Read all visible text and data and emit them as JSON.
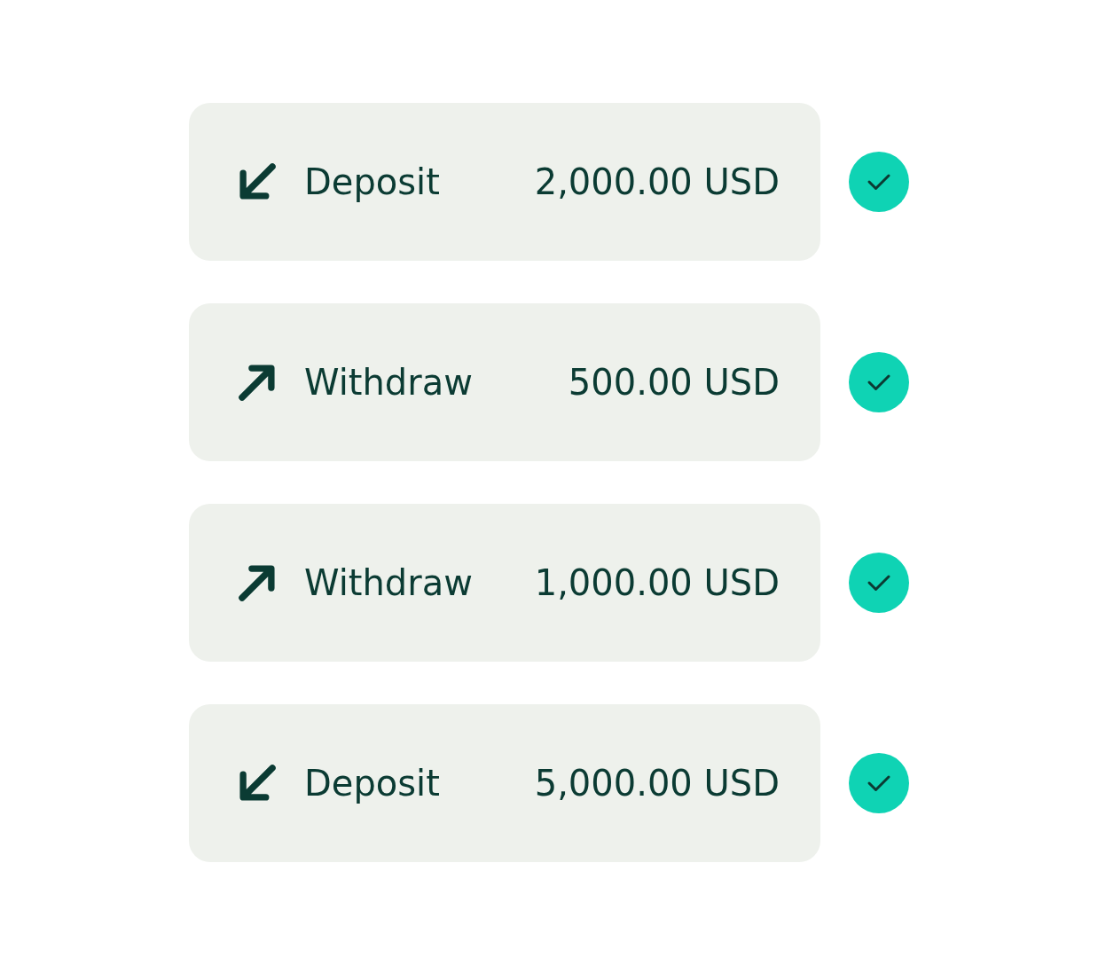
{
  "transactions": [
    {
      "kind": "deposit",
      "label": "Deposit",
      "amount": "2,000.00 USD",
      "completed": true
    },
    {
      "kind": "withdraw",
      "label": "Withdraw",
      "amount": "500.00 USD",
      "completed": true
    },
    {
      "kind": "withdraw",
      "label": "Withdraw",
      "amount": "1,000.00 USD",
      "completed": true
    },
    {
      "kind": "deposit",
      "label": "Deposit",
      "amount": "5,000.00 USD",
      "completed": true
    }
  ]
}
